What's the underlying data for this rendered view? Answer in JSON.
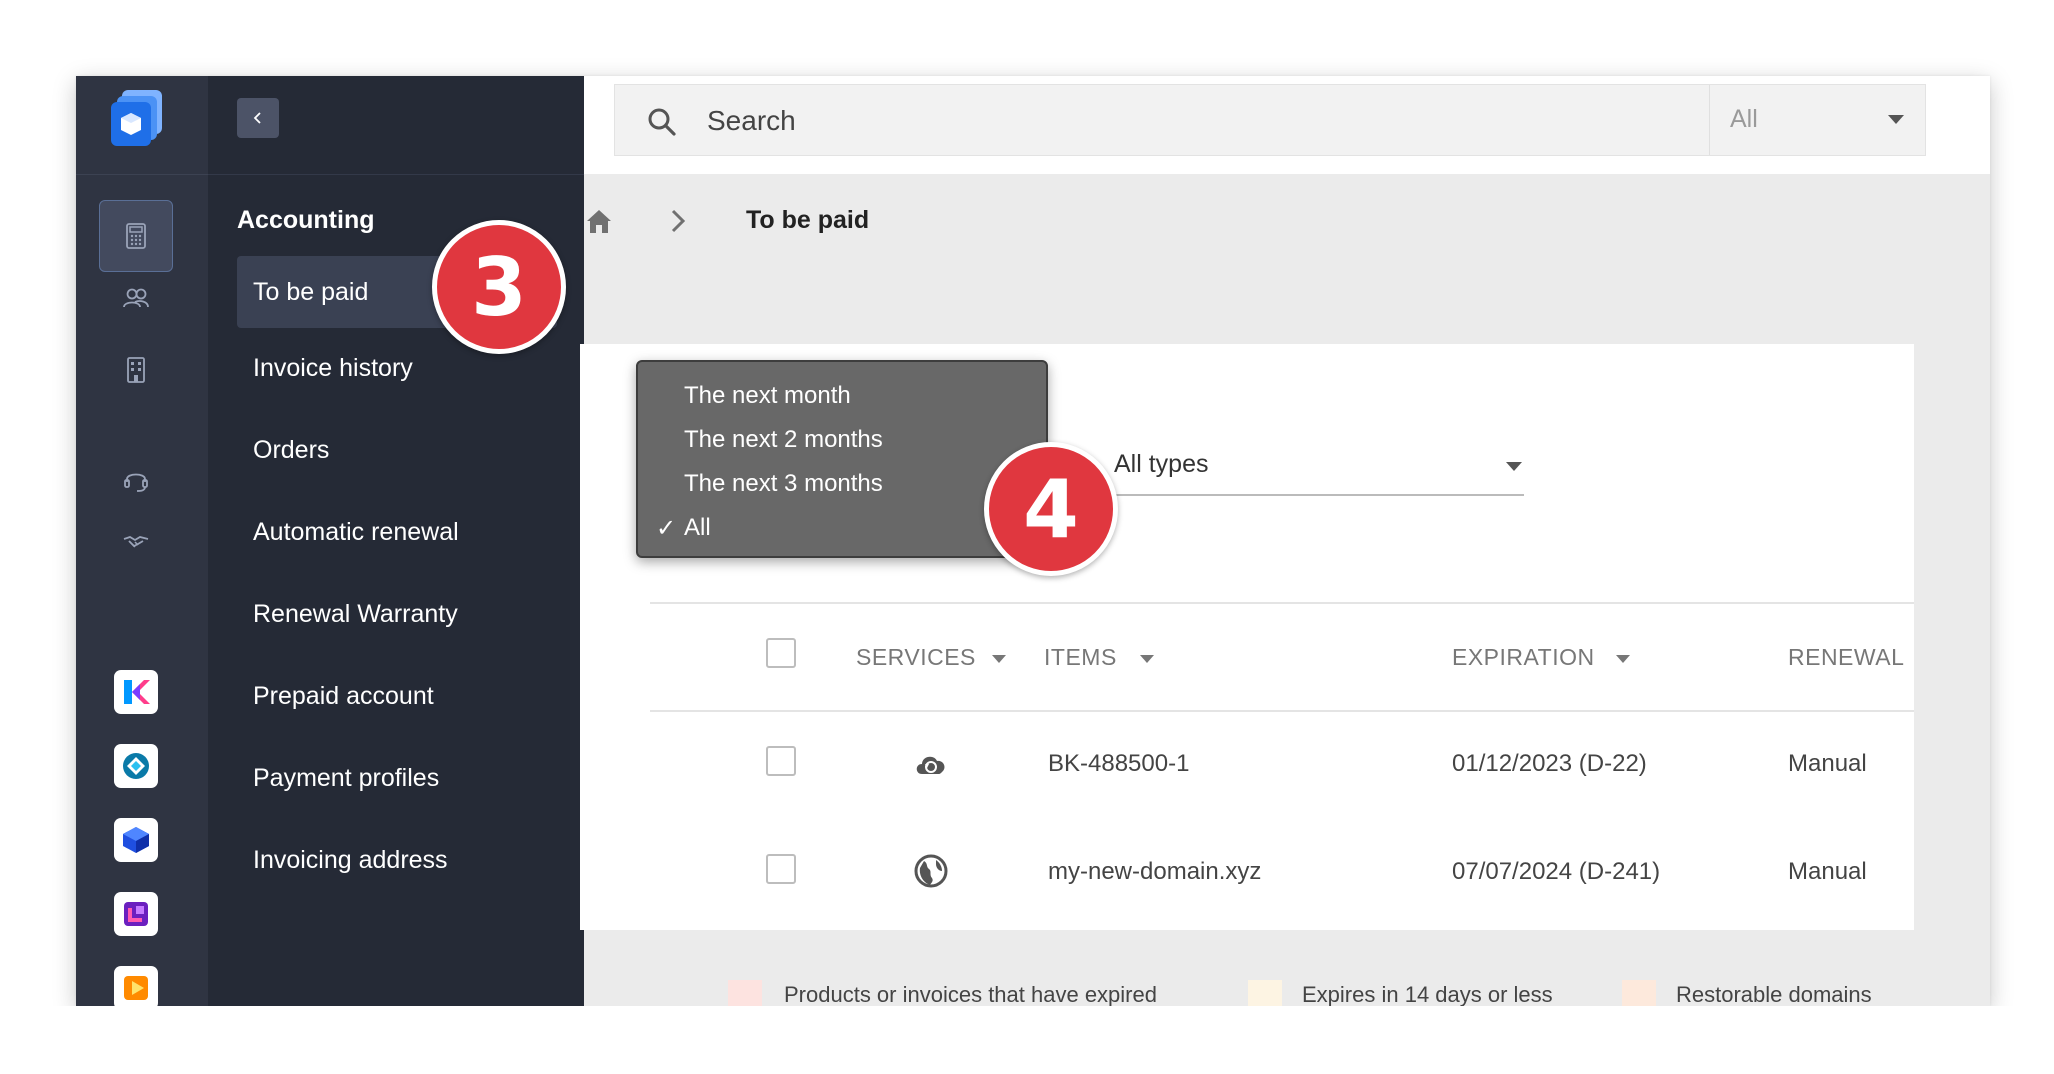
{
  "search": {
    "placeholder": "Search",
    "scope_value": "All"
  },
  "sidebar": {
    "section_title": "Accounting",
    "items": [
      {
        "label": "To be paid",
        "active": true
      },
      {
        "label": "Invoice history"
      },
      {
        "label": "Orders"
      },
      {
        "label": "Automatic renewal"
      },
      {
        "label": "Renewal Warranty"
      },
      {
        "label": "Prepaid account"
      },
      {
        "label": "Payment profiles"
      },
      {
        "label": "Invoicing address"
      }
    ]
  },
  "rail": {
    "icons": [
      "calculator-icon",
      "users-icon",
      "building-icon",
      "headset-icon",
      "handshake-icon"
    ],
    "apps": [
      "kmeet-app-icon",
      "kdrive-app-icon",
      "swiss-backup-app-icon",
      "kchat-app-icon",
      "streaming-app-icon"
    ]
  },
  "badges": {
    "step3": "3",
    "step4": "4"
  },
  "breadcrumb": {
    "current": "To be paid"
  },
  "filters": {
    "period_options": [
      "The next month",
      "The next 2 months",
      "The next 3 months",
      "All"
    ],
    "period_selected": "All",
    "check_mark": "✓",
    "type_value": "All types"
  },
  "table": {
    "columns": [
      "SERVICES",
      "ITEMS",
      "EXPIRATION",
      "RENEWAL"
    ],
    "rows": [
      {
        "service_icon": "cloud-backup-icon",
        "item": "BK-488500-1",
        "expiration": "01/12/2023 (D-22)",
        "renewal": "Manual"
      },
      {
        "service_icon": "globe-icon",
        "item": "my-new-domain.xyz",
        "expiration": "07/07/2024 (D-241)",
        "renewal": "Manual"
      }
    ]
  },
  "legend": [
    {
      "label": "Products or invoices that have expired",
      "color": "#fde3e0"
    },
    {
      "label": "Expires in 14 days or less",
      "color": "#fdf4e3"
    },
    {
      "label": "Restorable domains",
      "color": "#fde9dc"
    }
  ],
  "colors": {
    "badge": "#e0373f",
    "rail": "#2f3442",
    "sidebar": "#252a36"
  }
}
